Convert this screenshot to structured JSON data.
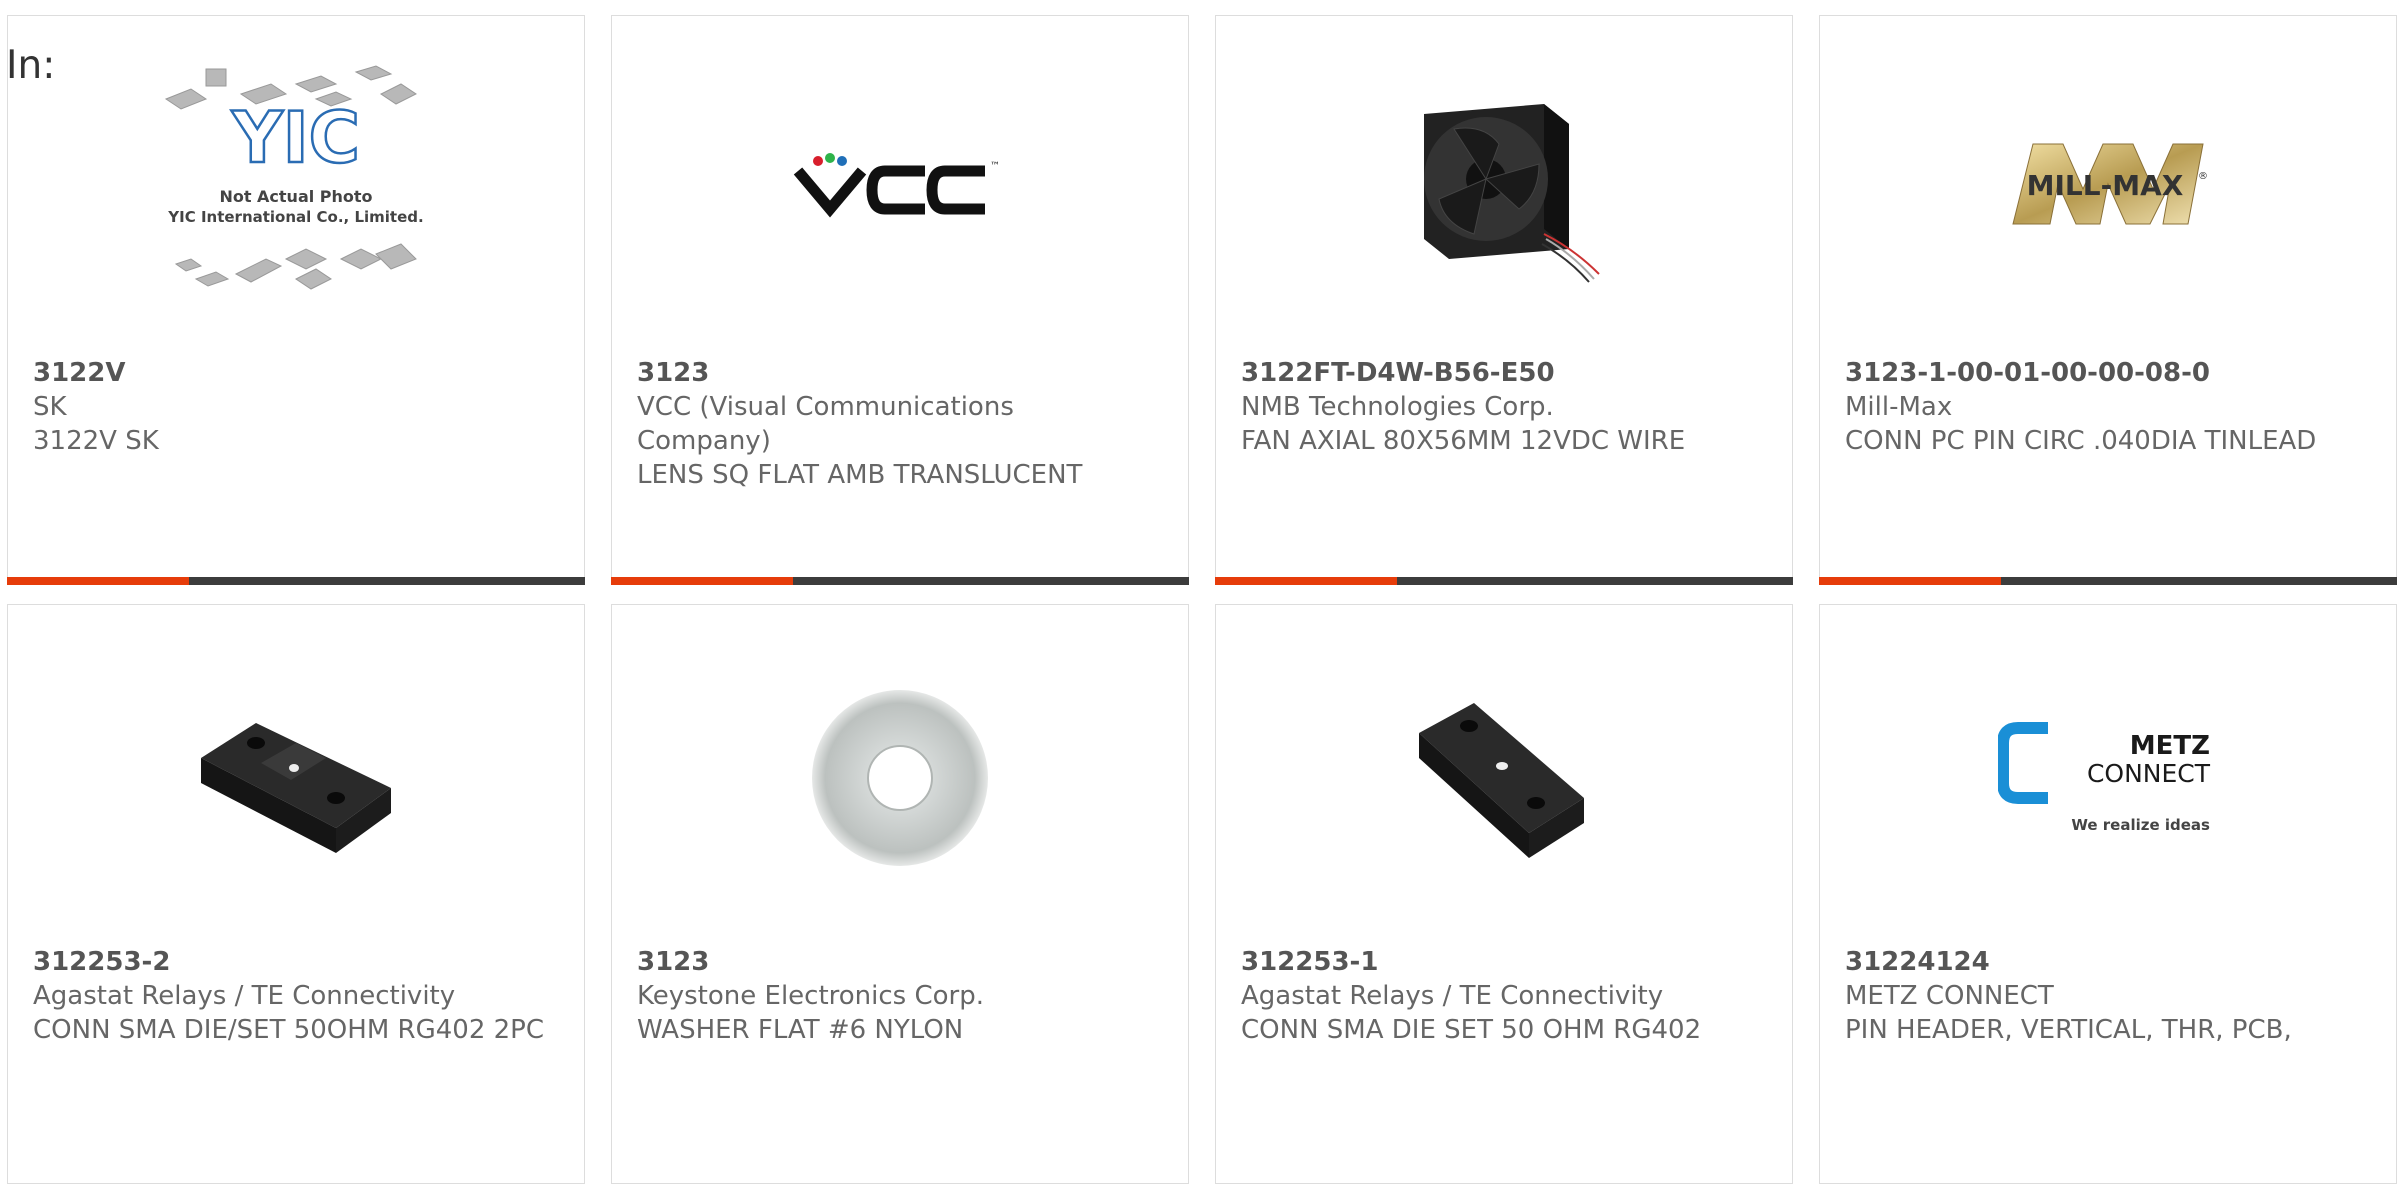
{
  "page": {
    "filter_label": "In:"
  },
  "products": [
    {
      "part_number": "3122V",
      "manufacturer": "SK",
      "description": "3122V SK",
      "image": "yic-not-actual-photo"
    },
    {
      "part_number": "3123",
      "manufacturer": "VCC (Visual Communications Company)",
      "description": "LENS SQ FLAT AMB TRANSLUCENT",
      "image": "vcc-logo"
    },
    {
      "part_number": "3122FT-D4W-B56-E50",
      "manufacturer": "NMB Technologies Corp.",
      "description": "FAN AXIAL 80X56MM 12VDC WIRE",
      "image": "axial-fan-photo"
    },
    {
      "part_number": "3123-1-00-01-00-00-08-0",
      "manufacturer": "Mill-Max",
      "description": "CONN PC PIN CIRC .040DIA TINLEAD",
      "image": "mill-max-logo"
    },
    {
      "part_number": "312253-2",
      "manufacturer": "Agastat Relays / TE Connectivity",
      "description": "CONN SMA DIE/SET 50OHM RG402 2PC",
      "image": "die-set-photo"
    },
    {
      "part_number": "3123",
      "manufacturer": "Keystone Electronics Corp.",
      "description": "WASHER FLAT #6 NYLON",
      "image": "washer-photo"
    },
    {
      "part_number": "312253-1",
      "manufacturer": "Agastat Relays / TE Connectivity",
      "description": "CONN SMA DIE SET 50 OHM RG402",
      "image": "die-set-photo"
    },
    {
      "part_number": "31224124",
      "manufacturer": "METZ CONNECT",
      "description": "PIN HEADER, VERTICAL, THR, PCB,",
      "image": "metz-connect-logo"
    }
  ],
  "logos": {
    "yic": {
      "brand": "YIC",
      "line1": "Not Actual Photo",
      "line2": "YIC International Co., Limited."
    },
    "vcc": {
      "brand": "VCC",
      "tm": "™"
    },
    "millmax": {
      "brand": "MILL-MAX",
      "reg": "®"
    },
    "metz": {
      "line1": "METZ",
      "line2": "CONNECT",
      "tagline": "We realize ideas"
    }
  },
  "colors": {
    "accent": "#e63c0a",
    "bar": "#3c3c3c",
    "text": "#666666",
    "border": "#dddddd",
    "metz_blue": "#1a8fd6"
  }
}
